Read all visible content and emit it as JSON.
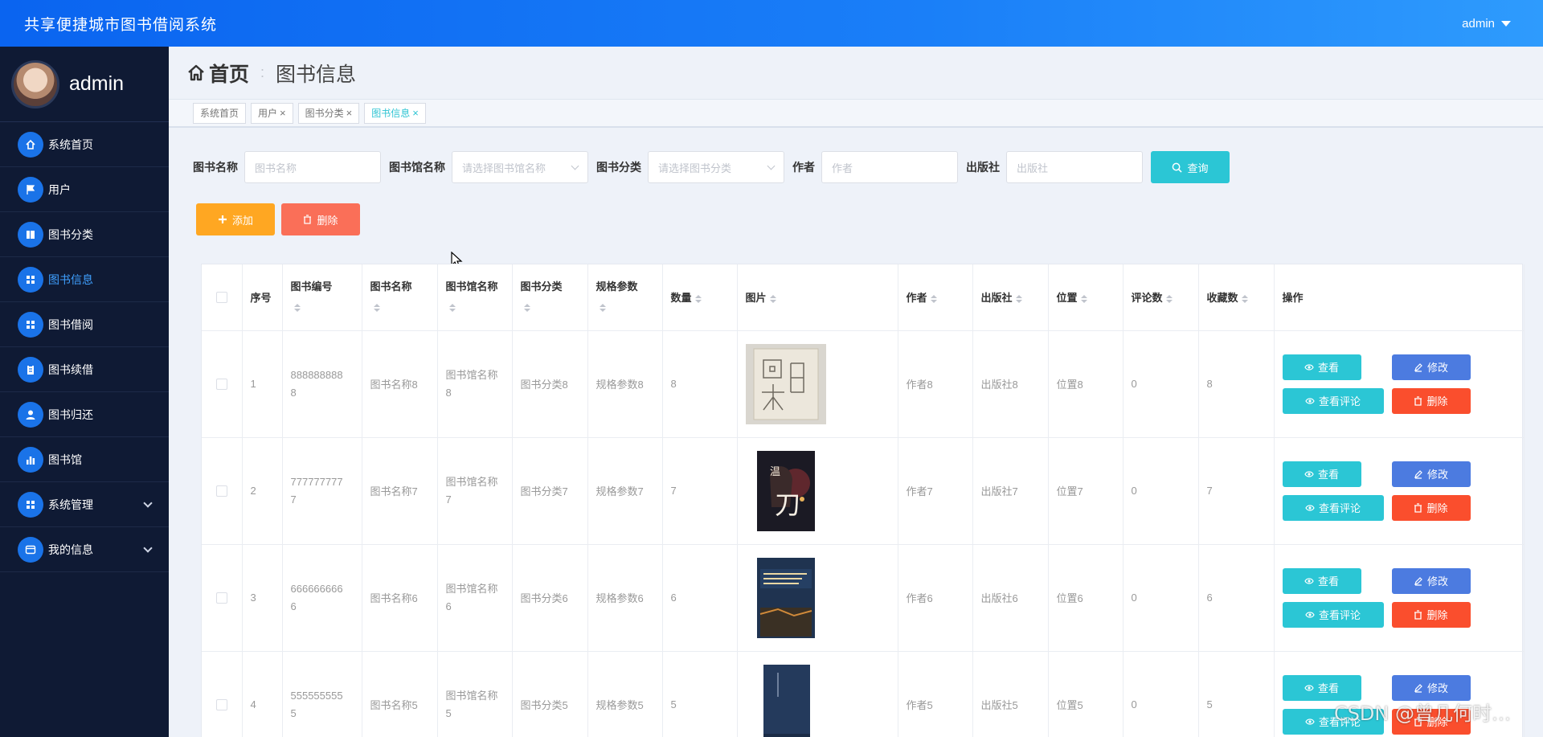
{
  "header": {
    "title": "共享便捷城市图书借阅系统",
    "user": "admin"
  },
  "sidebar": {
    "profile_name": "admin",
    "items": [
      {
        "label": "系统首页",
        "icon": "home-icon",
        "active": false,
        "expandable": false
      },
      {
        "label": "用户",
        "icon": "flag-icon",
        "active": false,
        "expandable": false
      },
      {
        "label": "图书分类",
        "icon": "book-icon",
        "active": false,
        "expandable": false
      },
      {
        "label": "图书信息",
        "icon": "grid-icon",
        "active": true,
        "expandable": false
      },
      {
        "label": "图书借阅",
        "icon": "grid-icon",
        "active": false,
        "expandable": false
      },
      {
        "label": "图书续借",
        "icon": "clipboard-icon",
        "active": false,
        "expandable": false
      },
      {
        "label": "图书归还",
        "icon": "user-icon",
        "active": false,
        "expandable": false
      },
      {
        "label": "图书馆",
        "icon": "chart-icon",
        "active": false,
        "expandable": false
      },
      {
        "label": "系统管理",
        "icon": "grid-icon",
        "active": false,
        "expandable": true
      },
      {
        "label": "我的信息",
        "icon": "card-icon",
        "active": false,
        "expandable": true
      }
    ]
  },
  "breadcrumb": {
    "home": "首页",
    "current": "图书信息"
  },
  "tabs": [
    {
      "label": "系统首页",
      "closable": false,
      "active": false
    },
    {
      "label": "用户",
      "closable": true,
      "active": false
    },
    {
      "label": "图书分类",
      "closable": true,
      "active": false
    },
    {
      "label": "图书信息",
      "closable": true,
      "active": true
    }
  ],
  "search": {
    "name_label": "图书名称",
    "name_placeholder": "图书名称",
    "library_label": "图书馆名称",
    "library_placeholder": "请选择图书馆名称",
    "category_label": "图书分类",
    "category_placeholder": "请选择图书分类",
    "author_label": "作者",
    "author_placeholder": "作者",
    "publisher_label": "出版社",
    "publisher_placeholder": "出版社",
    "query_label": "查询"
  },
  "actions": {
    "add_label": "添加",
    "delete_label": "删除"
  },
  "table": {
    "columns": [
      "序号",
      "图书编号",
      "图书名称",
      "图书馆名称",
      "图书分类",
      "规格参数",
      "数量",
      "图片",
      "作者",
      "出版社",
      "位置",
      "评论数",
      "收藏数",
      "操作"
    ],
    "op_labels": {
      "view": "查看",
      "edit": "修改",
      "comments": "查看评论",
      "delete": "删除"
    },
    "rows": [
      {
        "index": "1",
        "code_a": "888888888",
        "code_b": "8",
        "name": "图书名称8",
        "library_a": "图书馆名称",
        "library_b": "8",
        "category": "图书分类8",
        "spec": "规格参数8",
        "qty": "8",
        "author": "作者8",
        "publisher": "出版社8",
        "location": "位置8",
        "comments": "0",
        "favorites": "8",
        "cover": "cream"
      },
      {
        "index": "2",
        "code_a": "777777777",
        "code_b": "7",
        "name": "图书名称7",
        "library_a": "图书馆名称",
        "library_b": "7",
        "category": "图书分类7",
        "spec": "规格参数7",
        "qty": "7",
        "author": "作者7",
        "publisher": "出版社7",
        "location": "位置7",
        "comments": "0",
        "favorites": "7",
        "cover": "dark"
      },
      {
        "index": "3",
        "code_a": "666666666",
        "code_b": "6",
        "name": "图书名称6",
        "library_a": "图书馆名称",
        "library_b": "6",
        "category": "图书分类6",
        "spec": "规格参数6",
        "qty": "6",
        "author": "作者6",
        "publisher": "出版社6",
        "location": "位置6",
        "comments": "0",
        "favorites": "6",
        "cover": "navy"
      },
      {
        "index": "4",
        "code_a": "555555555",
        "code_b": "5",
        "name": "图书名称5",
        "library_a": "图书馆名称",
        "library_b": "5",
        "category": "图书分类5",
        "spec": "规格参数5",
        "qty": "5",
        "author": "作者5",
        "publisher": "出版社5",
        "location": "位置5",
        "comments": "0",
        "favorites": "5",
        "cover": "blue"
      }
    ]
  },
  "watermark": "CSDN @曾几何时…",
  "colors": {
    "header": "#0a64f0",
    "sidebar": "#0f1a34",
    "query": "#2bc6d5",
    "add": "#ffa722",
    "delete": "#fa4e2d",
    "edit": "#4c7be0"
  }
}
